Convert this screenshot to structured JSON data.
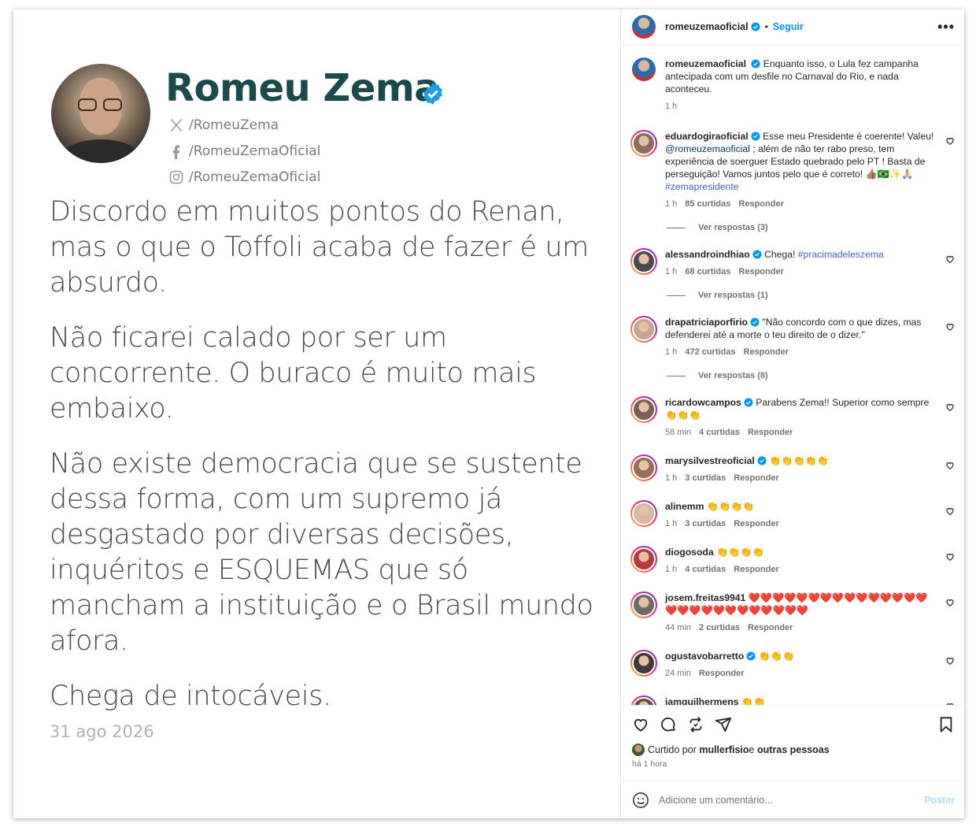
{
  "image": {
    "name": "Romeu Zema",
    "handles": [
      {
        "icon": "x-icon",
        "text": "/RomeuZema"
      },
      {
        "icon": "facebook-icon",
        "text": "/RomeuZemaOficial"
      },
      {
        "icon": "instagram-icon",
        "text": "/RomeuZemaOficial"
      }
    ],
    "paragraphs": [
      "Discordo em muitos pontos do Renan, mas o que o Toffoli acaba de fazer é um absurdo.",
      "Não ficarei calado por ser um concorrente. O buraco é muito mais embaixo.",
      "Não existe democracia que se sustente dessa forma, com um supremo já desgastado por diversas decisões, inquéritos e ESQUEMAS que só mancham a instituição e o Brasil mundo afora.",
      "Chega de intocáveis."
    ],
    "date": "31 ago 2026"
  },
  "header": {
    "username": "romeuzemaoficial",
    "separator": "•",
    "follow": "Seguir",
    "more": "•••"
  },
  "caption": {
    "username": "romeuzemaoficial",
    "text": "Enquanto isso, o Lula fez campanha antecipada com um desfile no Carnaval do Rio, e nada aconteceu.",
    "time": "1 h"
  },
  "comments": [
    {
      "user": "eduardogiraoficial",
      "verified": true,
      "text_a": "Esse meu Presidente é coerente! Valeu! ",
      "mention": "@romeuzemaoficial",
      "text_b": " ; além de não ter rabo preso, tem experiência de soerguer Estado quebrado pelo PT ! Basta de perseguição! Vamos juntos pelo que é correto! 👍🏽🇧🇷✨🙏🏼 ",
      "hashtag": "#zemapresidente",
      "time": "1 h",
      "likes": "85 curtidas",
      "reply": "Responder",
      "replies": "Ver respostas (3)",
      "avatar_color": "#8a6d5a"
    },
    {
      "user": "alessandroindhiao",
      "verified": true,
      "text_a": "Chega! ",
      "hashtag": "#pracimadeleszema",
      "time": "1 h",
      "likes": "68 curtidas",
      "reply": "Responder",
      "replies": "Ver respostas (1)",
      "avatar_color": "#4d4a4f"
    },
    {
      "user": "drapatriciaporfirio",
      "verified": true,
      "text_a": "\"Não concordo com o que dizes, mas defenderei até a morte o teu direito de o dizer.\"",
      "time": "1 h",
      "likes": "472 curtidas",
      "reply": "Responder",
      "replies": "Ver respostas (8)",
      "avatar_color": "#c9a58d"
    },
    {
      "user": "ricardowcampos",
      "verified": true,
      "text_a": "Parabens Zema!! Superior como sempre 👏👏👏",
      "time": "58 min",
      "likes": "4 curtidas",
      "reply": "Responder",
      "avatar_color": "#7a6150"
    },
    {
      "user": "marysilvestreoficial",
      "verified": true,
      "text_a": "👏👏👏👏👏",
      "time": "1 h",
      "likes": "3 curtidas",
      "reply": "Responder",
      "avatar_color": "#9b6b55"
    },
    {
      "user": "alinemm",
      "verified": false,
      "text_a": "👏👏👏👏",
      "time": "1 h",
      "likes": "3 curtidas",
      "reply": "Responder",
      "avatar_color": "#d9b8a0"
    },
    {
      "user": "diogosoda",
      "verified": false,
      "text_a": "👏👏👏👏",
      "time": "1 h",
      "likes": "4 curtidas",
      "reply": "Responder",
      "avatar_color": "#b83a3a"
    },
    {
      "user": "josem.freitas9941",
      "verified": false,
      "text_a": "❤️❤️❤️❤️❤️❤️❤️❤️❤️❤️❤️❤️❤️❤️❤️❤️❤️❤️❤️❤️❤️❤️❤️❤️❤️❤️❤️",
      "time": "44 min",
      "likes": "2 curtidas",
      "reply": "Responder",
      "avatar_color": "#6d6a64"
    },
    {
      "user": "ogustavobarretto",
      "verified": true,
      "text_a": "👏👏👏",
      "time": "24 min",
      "reply": "Responder",
      "avatar_color": "#3e3a38"
    },
    {
      "user": "iamguilhermens",
      "verified": false,
      "text_a": "👏👏",
      "avatar_color": "#5a4e3e"
    }
  ],
  "liked_by": {
    "prefix": "Curtido por ",
    "user": "mullerfisio",
    "middle": " e ",
    "rest": "outras pessoas"
  },
  "time_ago": "há 1 hora",
  "add_comment": {
    "placeholder": "Adicione um comentário...",
    "post": "Postar"
  },
  "colors": {
    "accent": "#0095f6",
    "name_title": "#1b4a4c",
    "hashtag": "#3f63c8"
  }
}
